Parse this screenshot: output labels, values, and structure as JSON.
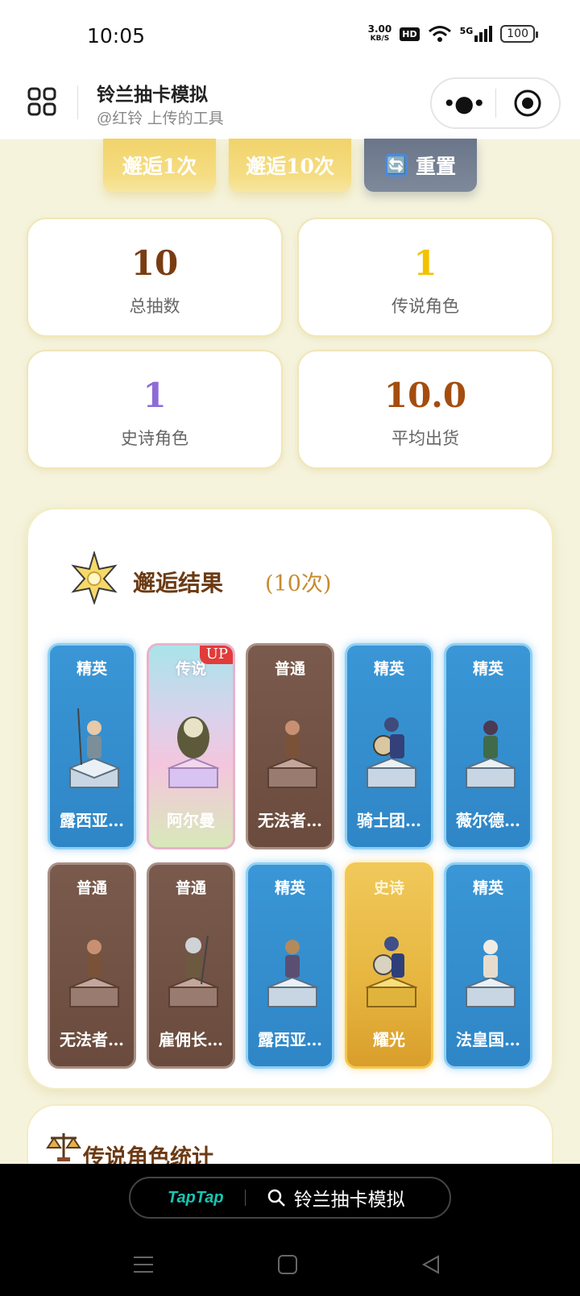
{
  "status_bar": {
    "time": "10:05",
    "net_speed_value": "3.00",
    "net_speed_unit": "KB/S",
    "hd": "HD",
    "network": "5G",
    "battery": "100"
  },
  "header": {
    "title": "铃兰抽卡模拟",
    "subtitle": "@红铃 上传的工具"
  },
  "actions": {
    "draw_one": "邂逅1次",
    "draw_ten": "邂逅10次",
    "reset_icon": "🔄",
    "reset": "重置"
  },
  "stats": [
    {
      "value": "10",
      "label": "总抽数",
      "color": "#7a3c12"
    },
    {
      "value": "1",
      "label": "传说角色",
      "color": "#f2c200"
    },
    {
      "value": "1",
      "label": "史诗角色",
      "color": "#8e6bd6"
    },
    {
      "value": "10.0",
      "label": "平均出货",
      "color": "#a44d0f"
    }
  ],
  "results": {
    "title": "邂逅结果",
    "count": "(10次)",
    "cards": [
      {
        "rarity": "精英",
        "name": "露西亚…",
        "tier": "elite"
      },
      {
        "rarity": "传说",
        "name": "阿尔曼",
        "tier": "legend",
        "badge": "UP"
      },
      {
        "rarity": "普通",
        "name": "无法者…",
        "tier": "common"
      },
      {
        "rarity": "精英",
        "name": "骑士团…",
        "tier": "elite"
      },
      {
        "rarity": "精英",
        "name": "薇尔德…",
        "tier": "elite"
      },
      {
        "rarity": "普通",
        "name": "无法者…",
        "tier": "common"
      },
      {
        "rarity": "普通",
        "name": "雇佣长…",
        "tier": "common"
      },
      {
        "rarity": "精英",
        "name": "露西亚…",
        "tier": "elite"
      },
      {
        "rarity": "史诗",
        "name": "耀光",
        "tier": "epic"
      },
      {
        "rarity": "精英",
        "name": "法皇国…",
        "tier": "elite"
      }
    ]
  },
  "legend_stats": {
    "title": "传说角色统计"
  },
  "taptap": {
    "logo": "TapTap",
    "search_text": "铃兰抽卡模拟"
  },
  "colors": {
    "background": "#f5f3dc",
    "elite": "#2f86c6",
    "common": "#6a4b3d",
    "epic": "#e6b53f",
    "title_brown": "#6b3a14"
  }
}
